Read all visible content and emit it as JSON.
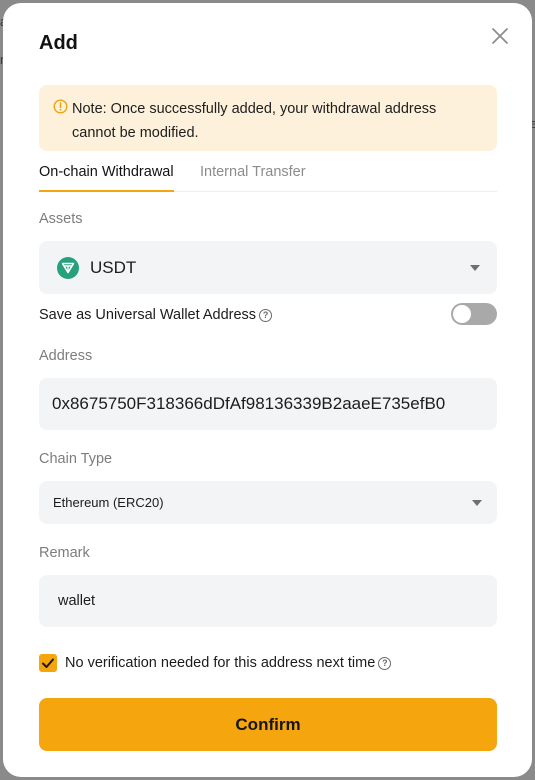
{
  "background": {
    "fragments": [
      "a",
      "r",
      "e"
    ]
  },
  "modal": {
    "title": "Add",
    "close_icon": "close-icon",
    "note": {
      "icon": "warning-circle-icon",
      "text": "Note: Once successfully added, your withdrawal address cannot be modified."
    },
    "tabs": [
      {
        "label": "On-chain Withdrawal",
        "active": true
      },
      {
        "label": "Internal Transfer",
        "active": false
      }
    ],
    "assets": {
      "label": "Assets",
      "value": "USDT",
      "icon": "usdt-token-icon"
    },
    "universal": {
      "label": "Save as Universal Wallet Address",
      "enabled": false
    },
    "address": {
      "label": "Address",
      "value": "0x8675750F318366dDfAf98136339B2aaeE735efB0"
    },
    "chain": {
      "label": "Chain Type",
      "value": "Ethereum (ERC20)"
    },
    "remark": {
      "label": "Remark",
      "value": "wallet"
    },
    "verification": {
      "label": "No verification needed for this address next time",
      "checked": true
    },
    "confirm_label": "Confirm",
    "colors": {
      "accent": "#f5a50d",
      "note_bg": "#fdf1dc",
      "field_bg": "#f3f4f5",
      "usdt": "#26a17b"
    }
  }
}
